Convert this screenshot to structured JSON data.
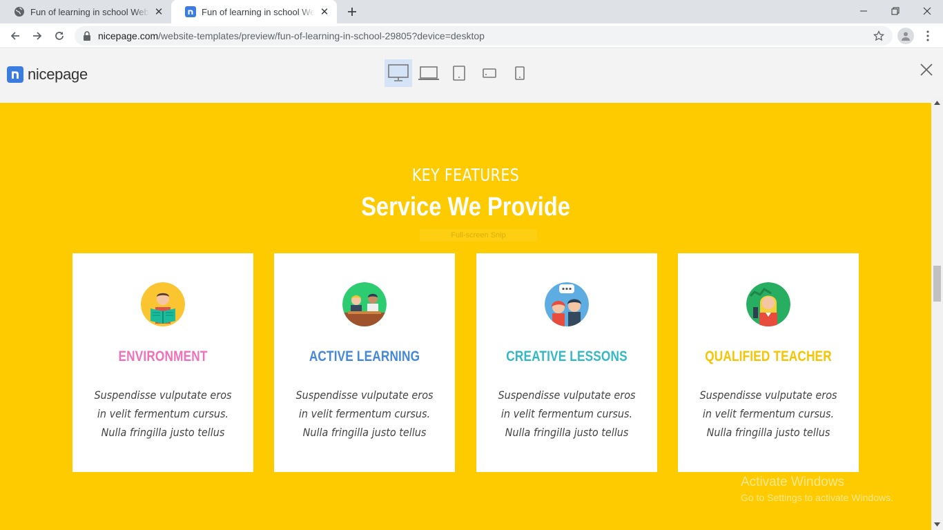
{
  "browser": {
    "tabs": [
      {
        "title": "Fun of learning in school Website Template",
        "favicon": "globe-icon",
        "active": false
      },
      {
        "title": "Fun of learning in school Website Template",
        "favicon": "nicepage-icon",
        "active": true
      }
    ],
    "url_host": "nicepage.com",
    "url_path": "/website-templates/preview/fun-of-learning-in-school-29805?device=desktop"
  },
  "preview_header": {
    "logo_text": "nicepage",
    "devices": [
      "desktop-icon",
      "laptop-icon",
      "tablet-icon",
      "tablet-landscape-icon",
      "phone-icon"
    ],
    "active_device": "desktop-icon"
  },
  "section": {
    "kicker": "KEY FEATURES",
    "heading": "Service We Provide",
    "snip_overlay": "Full-screen Snip",
    "background": "#fdcb00",
    "cards": [
      {
        "title": "ENVIRONMENT",
        "color": "#f070b9",
        "icon": "reading-student-icon",
        "text": [
          "Suspendisse vulputate eros",
          "in velit fermentum cursus.",
          "Nulla fringilla justo tellus"
        ]
      },
      {
        "title": "ACTIVE LEARNING",
        "color": "#4488dd",
        "icon": "two-students-icon",
        "text": [
          "Suspendisse vulputate eros",
          "in velit fermentum cursus.",
          "Nulla fringilla justo tellus"
        ]
      },
      {
        "title": "CREATIVE LESSONS",
        "color": "#33b8c4",
        "icon": "chatting-kids-icon",
        "text": [
          "Suspendisse vulputate eros",
          "in velit fermentum cursus.",
          "Nulla fringilla justo tellus"
        ]
      },
      {
        "title": "QUALIFIED TEACHER",
        "color": "#f6c400",
        "icon": "teacher-icon",
        "text": [
          "Suspendisse vulputate eros",
          "in velit fermentum cursus.",
          "Nulla fringilla justo tellus"
        ]
      }
    ]
  },
  "watermark": {
    "line1": "Activate Windows",
    "line2": "Go to Settings to activate Windows."
  }
}
